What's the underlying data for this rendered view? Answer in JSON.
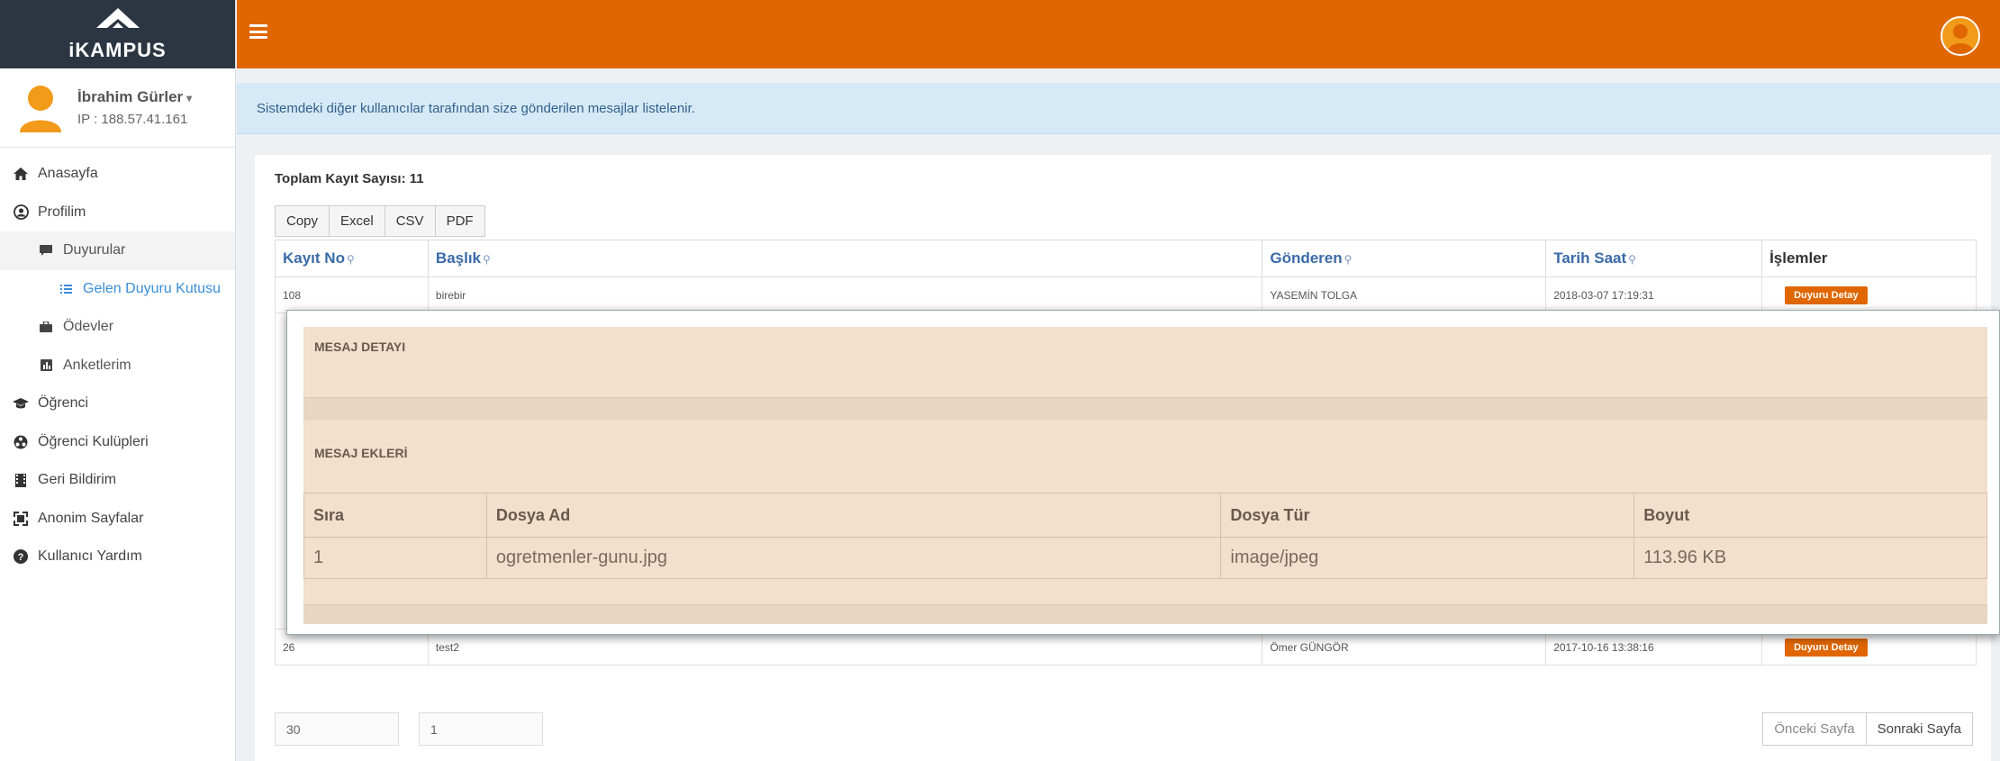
{
  "brand": {
    "name": "iKAMPUS"
  },
  "user": {
    "name": "İbrahim Gürler",
    "ip": "IP : 188.57.41.161"
  },
  "sidebar": {
    "items": [
      {
        "label": "Anasayfa",
        "icon": "home-icon"
      },
      {
        "label": "Profilim",
        "icon": "user-circle-icon"
      },
      {
        "label": "Duyurular",
        "icon": "comment-icon"
      },
      {
        "label": "Gelen Duyuru Kutusu",
        "icon": "list-icon"
      },
      {
        "label": "Ödevler",
        "icon": "briefcase-icon"
      },
      {
        "label": "Anketlerim",
        "icon": "poll-icon"
      },
      {
        "label": "Öğrenci",
        "icon": "graduation-cap-icon"
      },
      {
        "label": "Öğrenci Kulüpleri",
        "icon": "clubs-icon"
      },
      {
        "label": "Geri Bildirim",
        "icon": "film-icon"
      },
      {
        "label": "Anonim Sayfalar",
        "icon": "expand-icon"
      },
      {
        "label": "Kullanıcı Yardım",
        "icon": "question-circle-icon"
      }
    ]
  },
  "info_banner": "Sistemdeki diğer kullanıcılar tarafından size gönderilen mesajlar listelenir.",
  "main": {
    "total_label": "Toplam Kayıt Sayısı: 11",
    "export_buttons": [
      "Copy",
      "Excel",
      "CSV",
      "PDF"
    ],
    "columns": [
      "Kayıt No",
      "Başlık",
      "Gönderen",
      "Tarih Saat",
      "İşlemler"
    ],
    "rows": [
      {
        "id": "108",
        "title": "birebir",
        "sender": "YASEMİN TOLGA",
        "date": "2018-03-07 17:19:31",
        "action": "Duyuru Detay"
      },
      {
        "id": "26",
        "title": "test2",
        "sender": "Ömer GÜNGÖR",
        "date": "2017-10-16 13:38:16",
        "action": "Duyuru Detay"
      }
    ],
    "pager": {
      "page_size": "30",
      "page_number": "1",
      "prev_label": "Önceki Sayfa",
      "next_label": "Sonraki Sayfa"
    }
  },
  "modal": {
    "detail_title": "MESAJ DETAYI",
    "attachments_title": "MESAJ EKLERİ",
    "columns": [
      "Sıra",
      "Dosya Ad",
      "Dosya Tür",
      "Boyut"
    ],
    "rows": [
      {
        "order": "1",
        "file_name": "ogretmenler-gunu.jpg",
        "file_type": "image/jpeg",
        "size": "113.96 KB"
      }
    ]
  },
  "colors": {
    "accent": "#e06600",
    "brand_dark": "#2b3642",
    "banner": "#d6e9f6",
    "modal_bg": "#f2dfcc"
  }
}
